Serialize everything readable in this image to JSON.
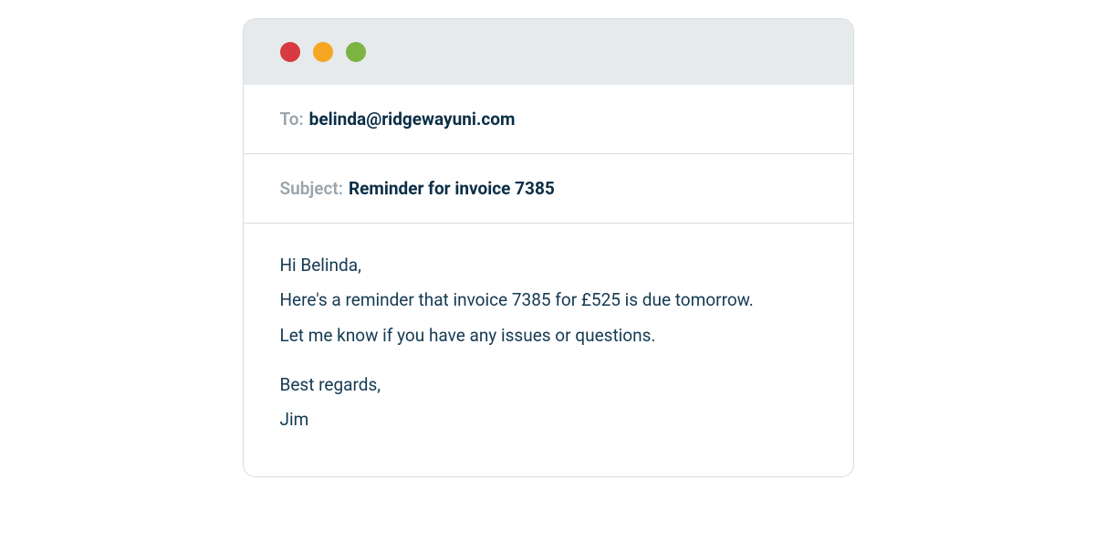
{
  "email": {
    "to_label": "To:",
    "to_value": "belinda@ridgewayuni.com",
    "subject_label": "Subject:",
    "subject_value": "Reminder for invoice 7385",
    "body": {
      "greeting": "Hi Belinda,",
      "line1": "Here's a reminder that invoice 7385 for £525 is due tomorrow.",
      "line2": "Let me know if you have any issues or questions.",
      "signoff": "Best regards,",
      "sender": "Jim"
    }
  },
  "colors": {
    "traffic_red": "#d73a3f",
    "traffic_yellow": "#f5a623",
    "traffic_green": "#7cb342"
  }
}
